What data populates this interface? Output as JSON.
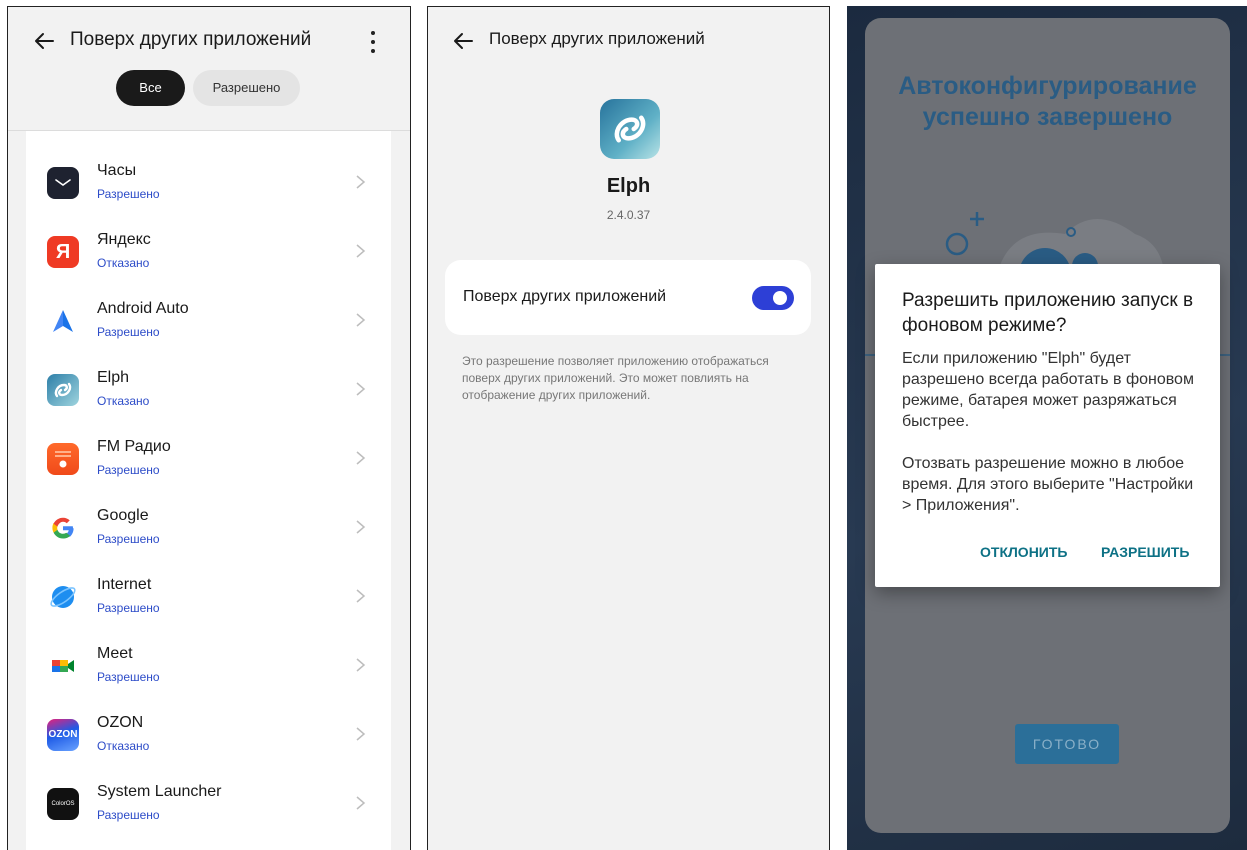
{
  "panel1": {
    "title": "Поверх других приложений",
    "filters": {
      "all": "Все",
      "allowed": "Разрешено"
    },
    "apps": [
      {
        "name": "Часы",
        "status": "Разрешено",
        "icon": "clock-icon"
      },
      {
        "name": "Яндекс",
        "status": "Отказано",
        "icon": "yandex-icon"
      },
      {
        "name": "Android Auto",
        "status": "Разрешено",
        "icon": "android-auto-icon"
      },
      {
        "name": "Elph",
        "status": "Отказано",
        "icon": "elph-icon"
      },
      {
        "name": "FM Радио",
        "status": "Разрешено",
        "icon": "fm-radio-icon"
      },
      {
        "name": "Google",
        "status": "Разрешено",
        "icon": "google-icon"
      },
      {
        "name": "Internet",
        "status": "Разрешено",
        "icon": "internet-icon"
      },
      {
        "name": "Meet",
        "status": "Разрешено",
        "icon": "meet-icon"
      },
      {
        "name": "OZON",
        "status": "Отказано",
        "icon": "ozon-icon"
      },
      {
        "name": "System Launcher",
        "status": "Разрешено",
        "icon": "system-launcher-icon",
        "icon_text": "ColorOS"
      }
    ],
    "yandex_letter": "Я",
    "ozon_text": "OZON"
  },
  "panel2": {
    "title": "Поверх других приложений",
    "app_name": "Elph",
    "app_version": "2.4.0.37",
    "toggle_label": "Поверх других приложений",
    "toggle_on": true,
    "description": "Это разрешение позволяет приложению отображаться поверх других приложений. Это может повлиять на отображение других приложений."
  },
  "panel3": {
    "headline_line1": "Автоконфигурирование",
    "headline_line2": "успешно завершено",
    "done_button": "ГОТОВО",
    "dialog": {
      "title": "Разрешить приложению запуск в фоновом режиме?",
      "body1": "Если приложению \"Elph\" будет разрешено всегда работать в фоновом режиме, батарея может разряжаться быстрее.",
      "body2": "Отозвать разрешение можно в любое время. Для этого выберите \"Настройки > Приложения\".",
      "deny": "ОТКЛОНИТЬ",
      "allow": "РАЗРЕШИТЬ"
    }
  },
  "colors": {
    "status_blue": "#2d4cc8",
    "toggle_blue": "#2d3fd6",
    "dialog_button": "#0d7185",
    "headline": "#2a5c84"
  }
}
